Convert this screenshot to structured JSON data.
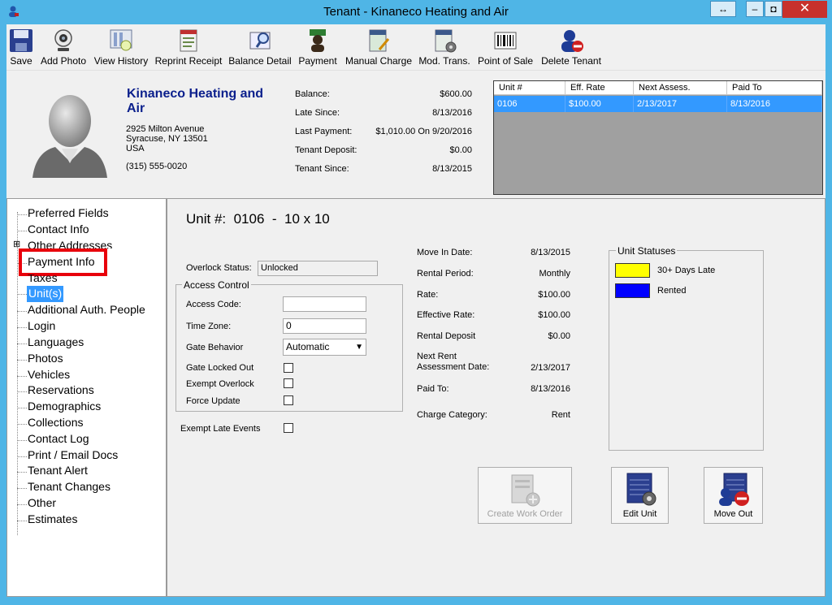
{
  "window": {
    "title": "Tenant -  Kinaneco Heating and Air",
    "restore_glyph": "↔",
    "minimize_glyph": "–",
    "maximize_glyph": "◘",
    "close_glyph": "✕"
  },
  "toolbar": {
    "save": "Save",
    "add_photo": "Add Photo",
    "view_history": "View History",
    "reprint_receipt": "Reprint Receipt",
    "balance_detail": "Balance Detail",
    "payment": "Payment",
    "manual_charge": "Manual Charge",
    "mod_trans": "Mod. Trans.",
    "point_of_sale": "Point of Sale",
    "delete_tenant": "Delete Tenant"
  },
  "tenant": {
    "name": "Kinaneco Heating and Air",
    "address1": "2925 Milton Avenue",
    "address2": "Syracuse, NY 13501",
    "country": "USA",
    "phone": "(315) 555-0020"
  },
  "summary": [
    {
      "label": "Balance:",
      "value": "$600.00"
    },
    {
      "label": "Late Since:",
      "value": "8/13/2016"
    },
    {
      "label": "Last Payment:",
      "value": "$1,010.00 On 9/20/2016"
    },
    {
      "label": "Tenant Deposit:",
      "value": "$0.00"
    },
    {
      "label": "Tenant Since:",
      "value": "8/13/2015"
    }
  ],
  "unit_grid": {
    "columns": [
      "Unit #",
      "Eff. Rate",
      "Next Assess.",
      "Paid To"
    ],
    "rows": [
      [
        "0106",
        "$100.00",
        "2/13/2017",
        "8/13/2016"
      ]
    ]
  },
  "nav": {
    "items": [
      "Preferred Fields",
      "Contact Info",
      "Other Addresses",
      "Payment Info",
      "Taxes",
      "Unit(s)",
      "Additional Auth. People",
      "Login",
      "Languages",
      "Photos",
      "Vehicles",
      "Reservations",
      "Demographics",
      "Collections",
      "Contact Log",
      "Print / Email Docs",
      "Tenant Alert",
      "Tenant Changes",
      "Other",
      "Estimates"
    ],
    "expander_glyph": "⊞",
    "highlight_color": "#e8000b",
    "selected_color": "#3399ff"
  },
  "unit_detail": {
    "heading_label": "Unit #:",
    "unit_number": "0106",
    "separator": "-",
    "size": "10 x 10",
    "overlock_label": "Overlock Status:",
    "overlock_value": "Unlocked",
    "access_control_title": "Access Control",
    "access_code_label": "Access Code:",
    "access_code_value": "",
    "time_zone_label": "Time Zone:",
    "time_zone_value": "0",
    "gate_behavior_label": "Gate Behavior",
    "gate_behavior_value": "Automatic",
    "gate_locked_out_label": "Gate Locked Out",
    "exempt_overlock_label": "Exempt Overlock",
    "force_update_label": "Force Update",
    "exempt_late_events_label": "Exempt Late Events"
  },
  "rental_info": [
    {
      "label": "Move In Date:",
      "value": "8/13/2015"
    },
    {
      "label": "Rental Period:",
      "value": "Monthly"
    },
    {
      "label": "Rate:",
      "value": "$100.00"
    },
    {
      "label": "Effective Rate:",
      "value": "$100.00"
    },
    {
      "label": "Rental Deposit",
      "value": "$0.00"
    },
    {
      "label": "Next Rent",
      "label2": "Assessment Date:",
      "value": "2/13/2017"
    },
    {
      "label": "Paid To:",
      "value": "8/13/2016"
    },
    {
      "label": "Charge Category:",
      "value": "Rent"
    }
  ],
  "unit_statuses": {
    "title": "Unit Statuses",
    "items": [
      {
        "label": "30+ Days Late",
        "color": "#ffff00"
      },
      {
        "label": "Rented",
        "color": "#0000ff"
      }
    ]
  },
  "actions": {
    "create_work_order": "Create Work Order",
    "edit_unit": "Edit Unit",
    "move_out": "Move Out"
  }
}
